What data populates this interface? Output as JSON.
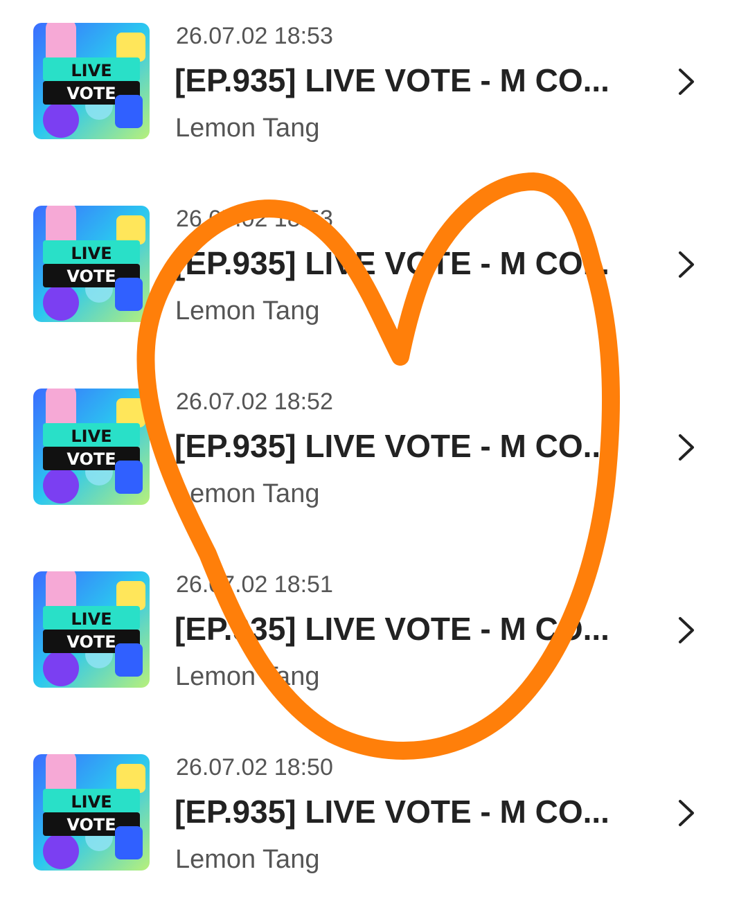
{
  "items": [
    {
      "timestamp": "26.07.02 18:53",
      "title": "[EP.935] LIVE VOTE - M CO...",
      "author": "Lemon Tang",
      "thumb_text": [
        "LIVE",
        "VOTE"
      ]
    },
    {
      "timestamp": "26.07.02 18:53",
      "title": "[EP.935] LIVE VOTE - M CO...",
      "author": "Lemon Tang",
      "thumb_text": [
        "LIVE",
        "VOTE"
      ]
    },
    {
      "timestamp": "26.07.02 18:52",
      "title": "[EP.935] LIVE VOTE - M CO...",
      "author": "Lemon Tang",
      "thumb_text": [
        "LIVE",
        "VOTE"
      ]
    },
    {
      "timestamp": "26.07.02 18:51",
      "title": "[EP.935] LIVE VOTE - M CO...",
      "author": "Lemon Tang",
      "thumb_text": [
        "LIVE",
        "VOTE"
      ]
    },
    {
      "timestamp": "26.07.02 18:50",
      "title": "[EP.935] LIVE VOTE - M CO...",
      "author": "Lemon Tang",
      "thumb_text": [
        "LIVE",
        "VOTE"
      ]
    }
  ],
  "icons": {
    "row_action": "chevron-right-icon",
    "annotation": "heart-drawing"
  },
  "colors": {
    "annotation_stroke": "#FF7F0A",
    "title_text": "#222222",
    "meta_text": "#555555"
  }
}
